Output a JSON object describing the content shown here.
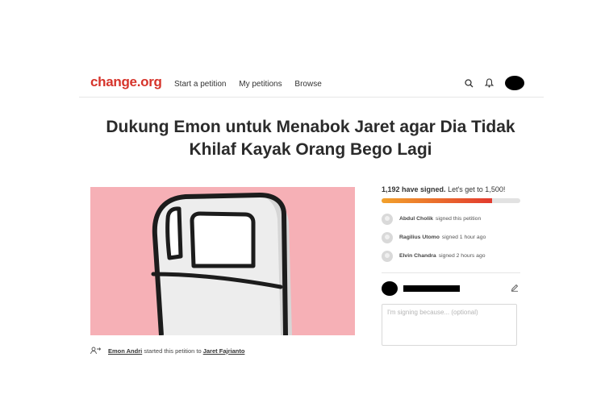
{
  "header": {
    "logo": "change.org",
    "nav": [
      "Start a petition",
      "My petitions",
      "Browse"
    ]
  },
  "petition": {
    "title_line1": "Dukung Emon untuk Menabok Jaret agar Dia Tidak",
    "title_line2": "Khilaf Kayak Orang Bego Lagi",
    "starter_name": "Emon Andri",
    "starter_text": "started this petition to",
    "target_name": "Jaret Fajrianto"
  },
  "progress": {
    "count_text": "1,192 have signed.",
    "goal_text": "Let's get to 1,500!",
    "signed": 1192,
    "goal": 1500
  },
  "signers": [
    {
      "name": "Abdul Cholik",
      "action": "signed this petition"
    },
    {
      "name": "Ragilius Utomo",
      "action": "signed 1 hour ago"
    },
    {
      "name": "Elvin Chandra",
      "action": "signed 2 hours ago"
    }
  ],
  "reason": {
    "placeholder": "I'm signing because... (optional)"
  },
  "colors": {
    "brand": "#d6342b",
    "hero_bg": "#f6b0b6"
  },
  "icons": [
    "search-icon",
    "bell-icon",
    "edit-icon",
    "share-person-icon"
  ]
}
